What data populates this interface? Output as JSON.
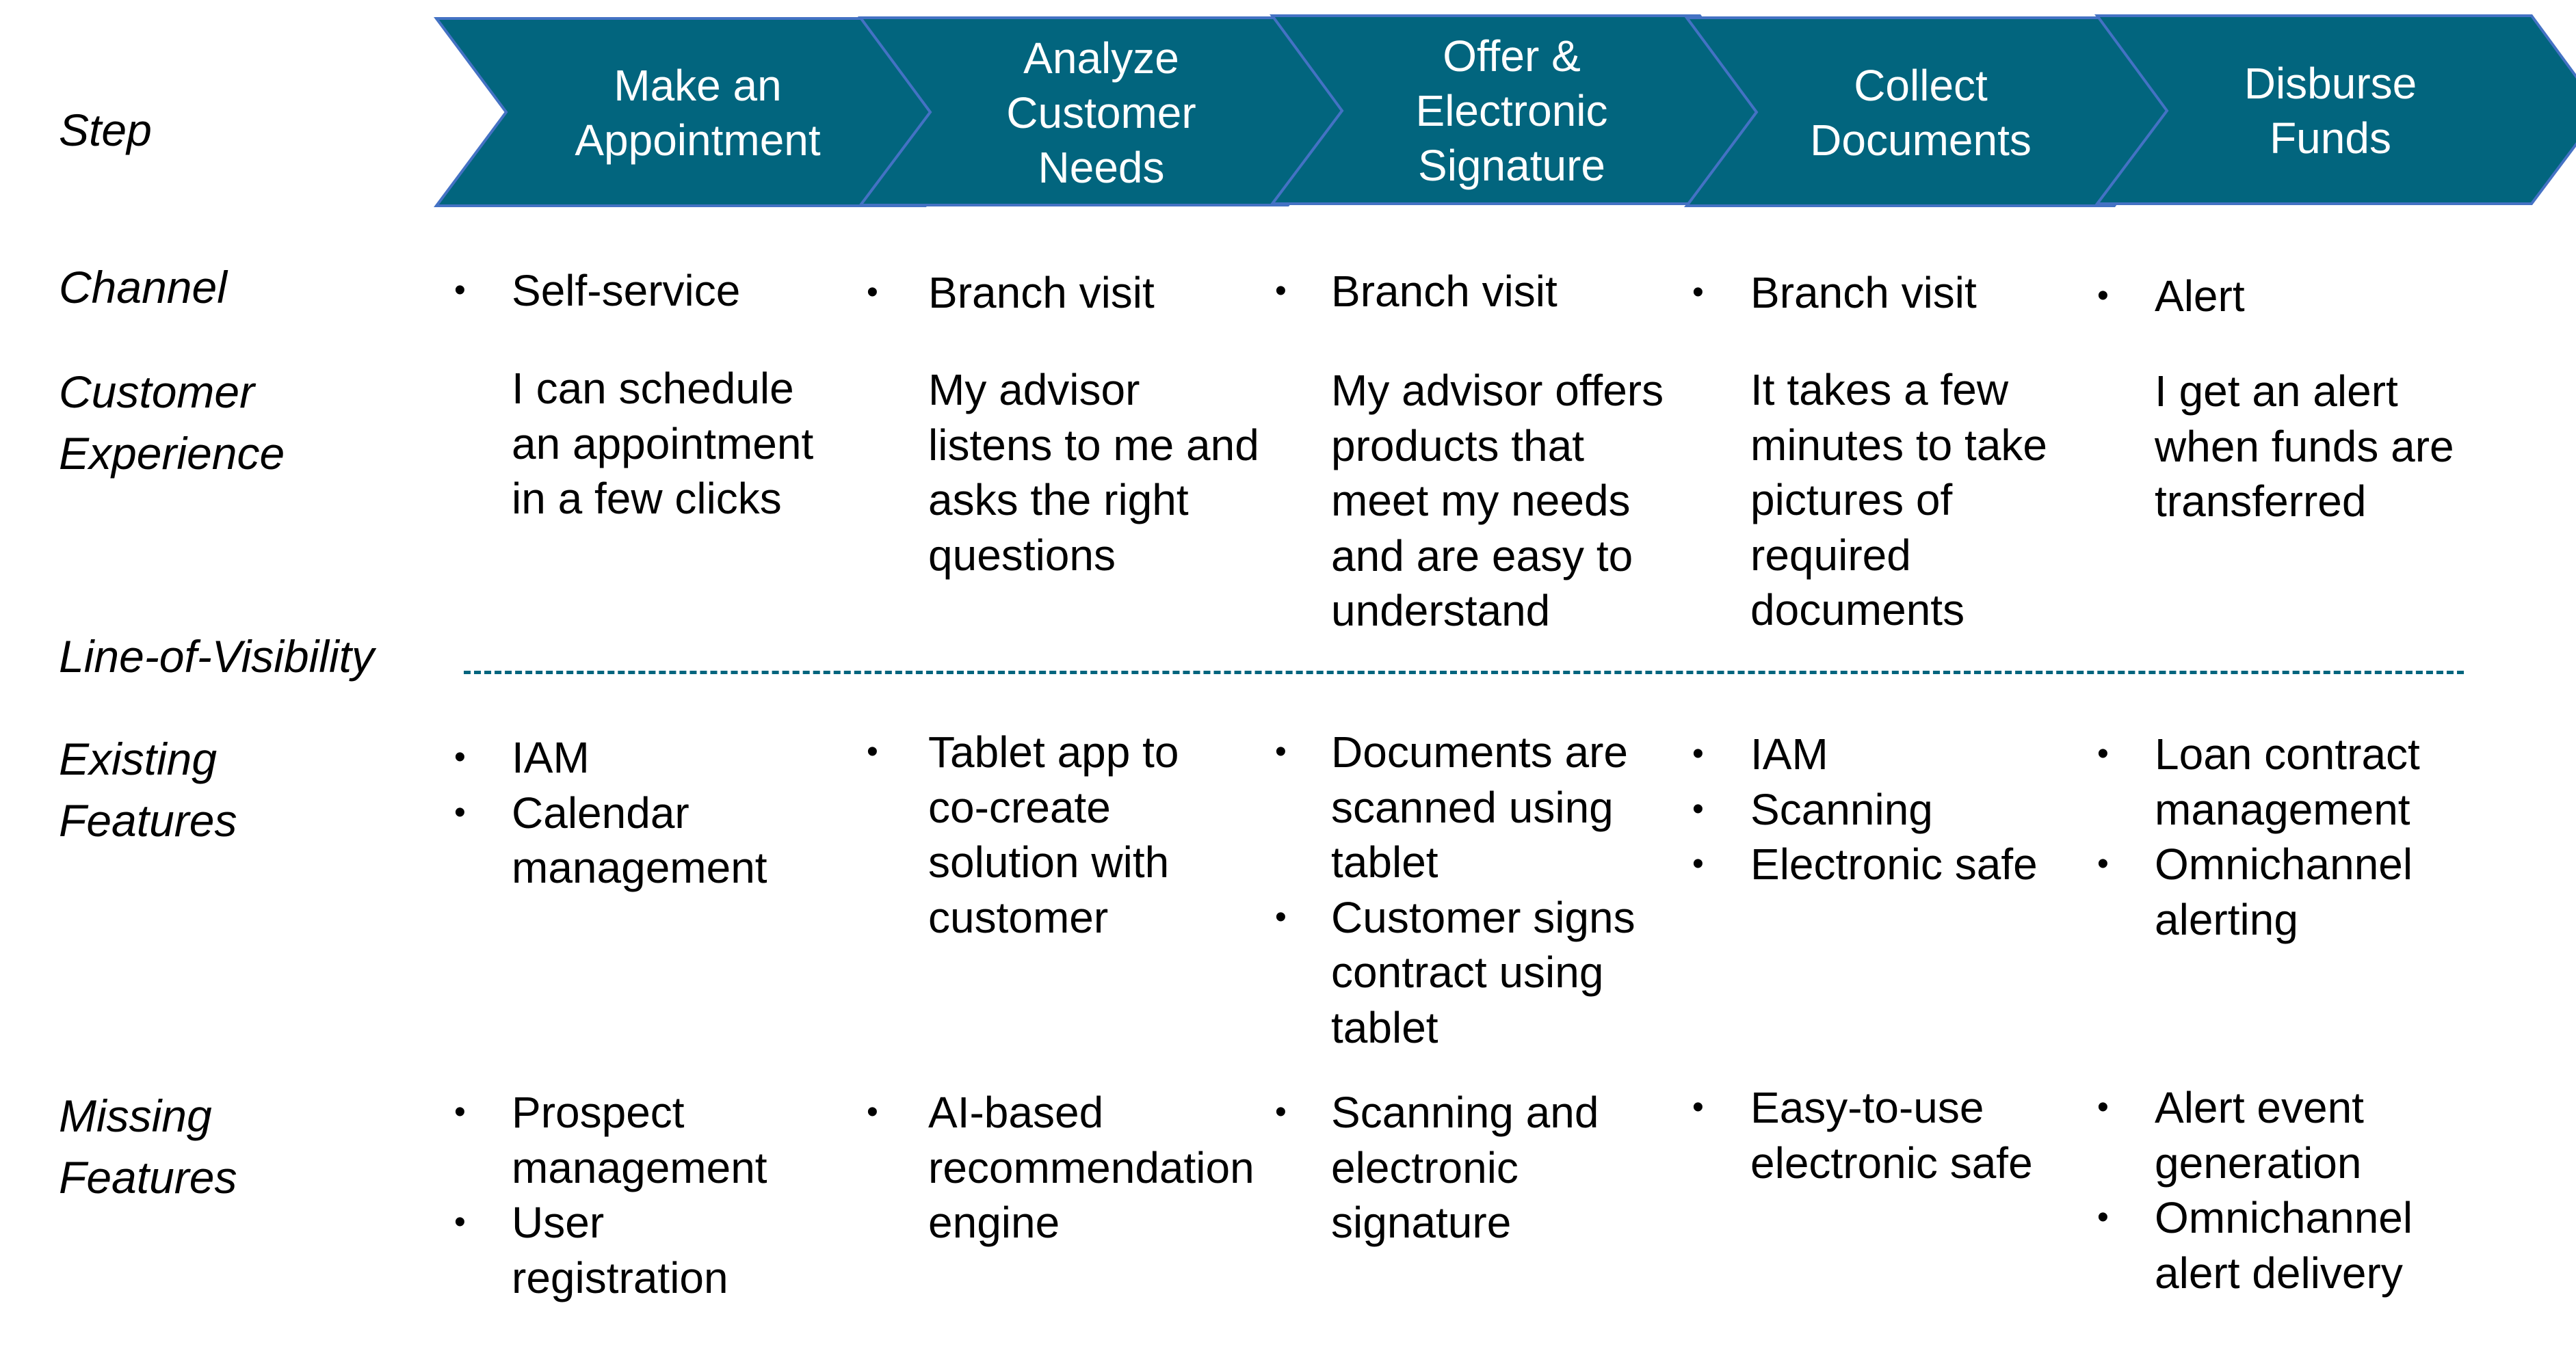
{
  "colors": {
    "chevron_fill": "#02657E",
    "chevron_border": "#4472C4",
    "visibility_line": "#02657E"
  },
  "row_labels": {
    "step": "Step",
    "channel": "Channel",
    "customer_experience": "Customer\nExperience",
    "line_of_visibility": "Line-of-Visibility",
    "existing_features": "Existing\nFeatures",
    "missing_features": "Missing\nFeatures"
  },
  "steps": [
    {
      "title": "Make an\nAppointment",
      "channel": [
        "Self-service"
      ],
      "experience": "I can schedule\nan appointment\nin a few clicks",
      "existing": [
        "IAM",
        "Calendar\nmanagement"
      ],
      "missing": [
        "Prospect\nmanagement",
        "User\nregistration"
      ]
    },
    {
      "title": "Analyze\nCustomer\nNeeds",
      "channel": [
        "Branch visit"
      ],
      "experience": "My advisor\nlistens to me and\nasks the right\nquestions",
      "existing": [
        "Tablet app to\nco-create\nsolution with\ncustomer"
      ],
      "missing": [
        "AI-based\nrecommendation\nengine"
      ]
    },
    {
      "title": "Offer &\nElectronic\nSignature",
      "channel": [
        "Branch visit"
      ],
      "experience": "My advisor offers\nproducts that\nmeet my needs\nand are easy to\nunderstand",
      "existing": [
        "Documents are\nscanned using\ntablet",
        "Customer signs\ncontract using\ntablet"
      ],
      "missing": [
        "Scanning and\nelectronic\nsignature"
      ]
    },
    {
      "title": "Collect\nDocuments",
      "channel": [
        "Branch visit"
      ],
      "experience": "It takes a few\nminutes to take\npictures of\nrequired\ndocuments",
      "existing": [
        "IAM",
        "Scanning",
        "Electronic safe"
      ],
      "missing": [
        "Easy-to-use\nelectronic safe"
      ]
    },
    {
      "title": "Disburse\nFunds",
      "channel": [
        "Alert"
      ],
      "experience": "I get an alert\nwhen funds are\ntransferred",
      "existing": [
        "Loan contract\nmanagement",
        "Omnichannel\nalerting"
      ],
      "missing": [
        "Alert event\ngeneration",
        "Omnichannel\nalert delivery"
      ]
    }
  ],
  "bullet_glyph": "•"
}
